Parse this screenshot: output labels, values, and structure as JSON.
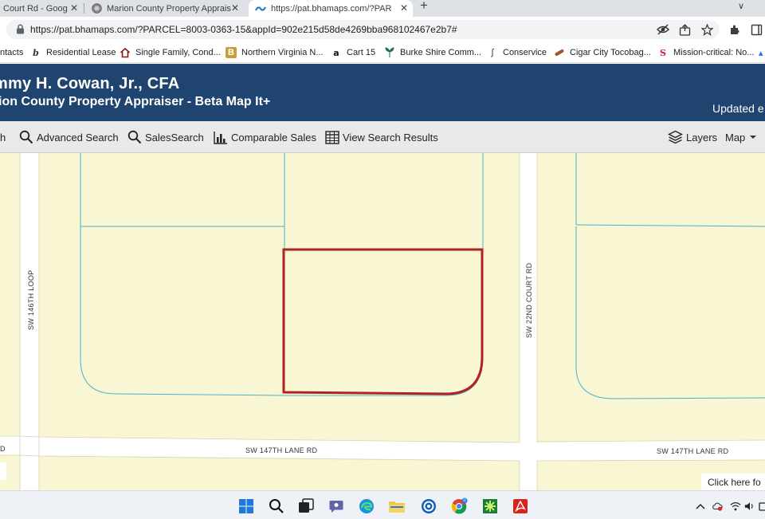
{
  "browser": {
    "tabs": [
      {
        "title": "Court Rd - Goog",
        "active": false
      },
      {
        "title": "Marion County Property Apprais",
        "active": false
      },
      {
        "title": "https://pat.bhamaps.com/?PARC",
        "active": true
      }
    ],
    "new_tab_label": "+",
    "tab_menu_label": "∨",
    "url": "https://pat.bhamaps.com/?PARCEL=8003-0363-15&appId=902e215d58de4269bba968102467e2b7#",
    "bookmarks": [
      {
        "label": "ntacts",
        "icon": "contacts-icon"
      },
      {
        "label": "Residential Lease",
        "icon": "lease-icon"
      },
      {
        "label": "Single Family, Cond...",
        "icon": "house-icon"
      },
      {
        "label": "Northern Virginia N...",
        "icon": "bookmark-b-icon"
      },
      {
        "label": "Cart 15",
        "icon": "amazon-icon"
      },
      {
        "label": "Burke Shire Comm...",
        "icon": "leaf-icon"
      },
      {
        "label": "Conservice",
        "icon": "conservice-icon"
      },
      {
        "label": "Cigar City Tocobag...",
        "icon": "cigar-icon"
      },
      {
        "label": "Mission-critical: No...",
        "icon": "s-icon"
      }
    ]
  },
  "app": {
    "appraiser_name": "mmy H. Cowan, Jr., CFA",
    "subtitle": "ion County Property Appraiser - Beta Map It+",
    "updated": "Updated e",
    "toolbar": [
      {
        "label": "h",
        "icon": ""
      },
      {
        "label": "Advanced Search",
        "icon": "search-icon"
      },
      {
        "label": "SalesSearch",
        "icon": "search-icon"
      },
      {
        "label": "Comparable Sales",
        "icon": "bar-chart-icon"
      },
      {
        "label": "View Search Results",
        "icon": "table-icon"
      }
    ],
    "layers_label": "Layers",
    "map_label": "Map"
  },
  "map": {
    "streets": {
      "sw_146th_loop": "SW 146TH LOOP",
      "sw_22nd_court_rd": "SW 22ND COURT RD",
      "sw_147th_lane_rd_left": "SW 147TH LANE RD",
      "sw_147th_lane_rd_right": "SW 147TH LANE RD",
      "edge_rd": "D"
    },
    "colors": {
      "parcel_fill": "#f9f6d4",
      "road": "#ffffff",
      "parcel_line": "#4fb0c6",
      "selected_parcel": "#b22222"
    },
    "help_tip": "Click here fo"
  },
  "taskbar": {
    "apps": [
      "windows-start-icon",
      "search-icon",
      "task-view-icon",
      "teams-chat-icon",
      "edge-icon",
      "file-explorer-icon",
      "outlook-icon",
      "chrome-icon",
      "game-icon",
      "acrobat-icon"
    ],
    "tray": [
      "chevron-up-icon",
      "cloud-icon",
      "wifi-icon",
      "volume-icon",
      "battery-icon"
    ]
  }
}
